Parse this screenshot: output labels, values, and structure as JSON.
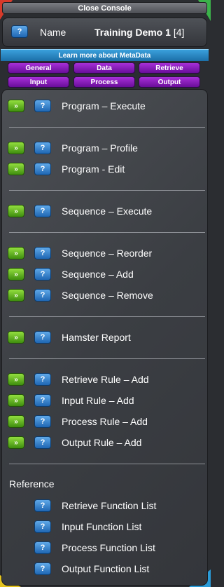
{
  "header": {
    "close_label": "Close Console",
    "name_label": "Name",
    "name_value": "Training Demo 1",
    "name_count": "[4]",
    "help_glyph": "?",
    "learn_more": "Learn more about MetaData"
  },
  "tabs": [
    "General",
    "Data",
    "Retrieve",
    "Input",
    "Process",
    "Output"
  ],
  "actions": [
    {
      "label": "Program – Execute"
    },
    {
      "label": "Program – Profile"
    },
    {
      "label": "Program - Edit"
    },
    {
      "label": "Sequence – Execute"
    },
    {
      "label": "Sequence – Reorder"
    },
    {
      "label": "Sequence – Add"
    },
    {
      "label": "Sequence – Remove"
    },
    {
      "label": "Hamster Report"
    },
    {
      "label": "Retrieve Rule – Add"
    },
    {
      "label": "Input Rule – Add"
    },
    {
      "label": "Process Rule – Add"
    },
    {
      "label": "Output Rule – Add"
    }
  ],
  "go_glyph": "»",
  "reference": {
    "title": "Reference",
    "items": [
      {
        "label": "Retrieve Function List"
      },
      {
        "label": "Input Function List"
      },
      {
        "label": "Process Function List"
      },
      {
        "label": "Output Function List"
      }
    ]
  },
  "colors": {
    "help_button": "#2a7fd0",
    "go_button": "#5cb31f",
    "tab_purple": "#8a1fc0",
    "learn_more_blue": "#2b8fcf"
  }
}
